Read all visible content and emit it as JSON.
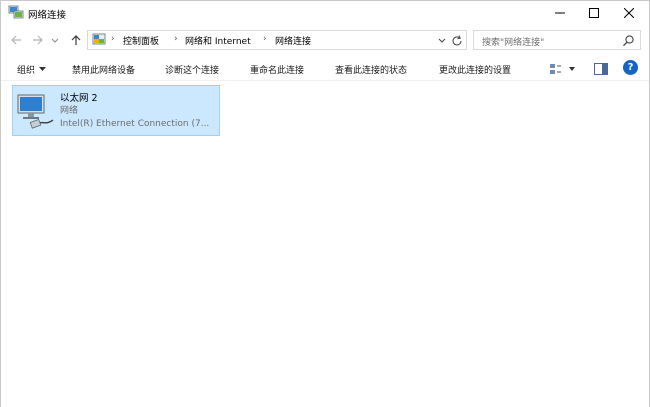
{
  "window": {
    "title": "网络连接",
    "controls": {
      "minimize": "minimize",
      "maximize": "maximize",
      "close": "close"
    }
  },
  "address": {
    "breadcrumb": [
      "控制面板",
      "网络和 Internet",
      "网络连接"
    ],
    "separator": "›",
    "search_placeholder": "搜索\"网络连接\""
  },
  "commands": {
    "organize": "组织",
    "disable_device": "禁用此网络设备",
    "diagnose": "诊断这个连接",
    "rename": "重命名此连接",
    "view_status": "查看此连接的状态",
    "change_settings": "更改此连接的设置",
    "help": "?"
  },
  "connections": [
    {
      "name": "以太网 2",
      "status": "网络",
      "device": "Intel(R) Ethernet Connection (7..."
    }
  ],
  "colors": {
    "selection_bg": "#cce8ff",
    "selection_border": "#99d1ff",
    "help_blue": "#1664c4"
  }
}
